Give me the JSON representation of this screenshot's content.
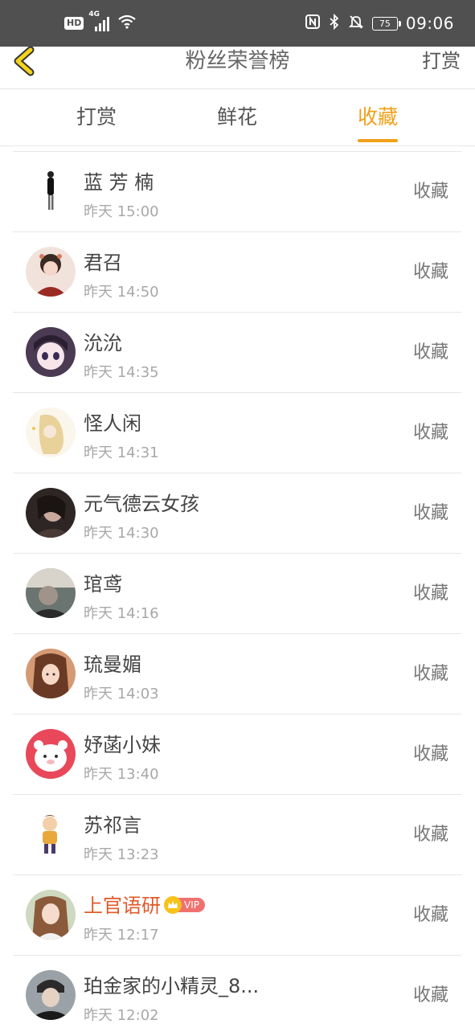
{
  "status_bar": {
    "hd": "HD",
    "network": "4G",
    "battery": "75",
    "time": "09:06"
  },
  "header": {
    "title": "粉丝荣誉榜",
    "action": "打赏"
  },
  "tabs": [
    {
      "label": "打赏",
      "active": false
    },
    {
      "label": "鲜花",
      "active": false
    },
    {
      "label": "收藏",
      "active": true
    }
  ],
  "colors": {
    "accent": "#f0a01a",
    "vip_name": "#e05a2a",
    "status_bar": "#505050"
  },
  "fans": [
    {
      "name": "蓝 芳 楠",
      "time": "昨天 15:00",
      "action": "收藏",
      "vip": false
    },
    {
      "name": "君召",
      "time": "昨天 14:50",
      "action": "收藏",
      "vip": false
    },
    {
      "name": "沇沇",
      "time": "昨天 14:35",
      "action": "收藏",
      "vip": false
    },
    {
      "name": "怪人闲",
      "time": "昨天 14:31",
      "action": "收藏",
      "vip": false
    },
    {
      "name": "元气德云女孩",
      "time": "昨天 14:30",
      "action": "收藏",
      "vip": false
    },
    {
      "name": "琯鸢",
      "time": "昨天 14:16",
      "action": "收藏",
      "vip": false
    },
    {
      "name": "琉曼媚",
      "time": "昨天 14:03",
      "action": "收藏",
      "vip": false
    },
    {
      "name": "妤菡小妹",
      "time": "昨天 13:40",
      "action": "收藏",
      "vip": false
    },
    {
      "name": "苏祁言",
      "time": "昨天 13:23",
      "action": "收藏",
      "vip": false
    },
    {
      "name": "上官语研",
      "time": "昨天 12:17",
      "action": "收藏",
      "vip": true,
      "vip_label": "VIP"
    },
    {
      "name": "珀金家的小精灵_8...",
      "time": "昨天 12:02",
      "action": "收藏",
      "vip": false
    }
  ]
}
